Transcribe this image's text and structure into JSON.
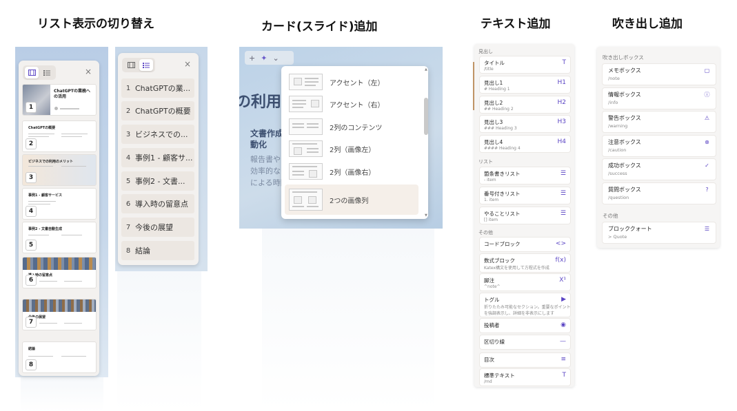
{
  "titles": {
    "list_toggle": "リスト表示の切り替え",
    "add_card": "カード(スライド)追加",
    "add_text": "テキスト追加",
    "add_callout": "吹き出し追加"
  },
  "thumb_panel": {
    "close": "×",
    "slides": [
      {
        "num": "1",
        "title": "ChatGPTの業務への活用"
      },
      {
        "num": "2",
        "title": "ChatGPTの概要"
      },
      {
        "num": "3",
        "title": "ビジネスでの利用のメリット"
      },
      {
        "num": "4",
        "title": "事例1 - 顧客サービス"
      },
      {
        "num": "5",
        "title": "事例2 - 文書自動生成"
      },
      {
        "num": "6",
        "title": "導入時の留意点"
      },
      {
        "num": "7",
        "title": "今後の展望"
      },
      {
        "num": "8",
        "title": "結論"
      }
    ]
  },
  "list_panel": {
    "close": "×",
    "items": [
      {
        "num": "1",
        "label": "ChatGPTの業..."
      },
      {
        "num": "2",
        "label": "ChatGPTの概要"
      },
      {
        "num": "3",
        "label": "ビジネスでの..."
      },
      {
        "num": "4",
        "label": "事例1 - 顧客サ..."
      },
      {
        "num": "5",
        "label": "事例2 - 文書..."
      },
      {
        "num": "6",
        "label": "導入時の留意点"
      },
      {
        "num": "7",
        "label": "今後の展望"
      },
      {
        "num": "8",
        "label": "結論"
      }
    ]
  },
  "card_panel": {
    "toolbar_plus": "+",
    "toolbar_magic": "✦",
    "toolbar_chevron": "⌄",
    "heading": "の利用の",
    "subheading": "文書作成",
    "subheading2": "動化",
    "body1": "報告書やメ",
    "body2": "効率的な自",
    "body3": "による時間",
    "options": [
      {
        "label": "アクセント（左）"
      },
      {
        "label": "アクセント（右）"
      },
      {
        "label": "2列のコンテンツ"
      },
      {
        "label": "2列（画像左）"
      },
      {
        "label": "2列（画像右）"
      },
      {
        "label": "2つの画像列"
      }
    ]
  },
  "text_panel": {
    "groups": {
      "heading": "見出し",
      "list": "リスト",
      "other": "その他"
    },
    "items": [
      {
        "name": "タイトル",
        "sub": "/title",
        "icon": "T"
      },
      {
        "name": "見出し1",
        "sub": "# Heading 1",
        "icon": "H1"
      },
      {
        "name": "見出し2",
        "sub": "## Heading 2",
        "icon": "H2"
      },
      {
        "name": "見出し3",
        "sub": "### Heading 3",
        "icon": "H3"
      },
      {
        "name": "見出し4",
        "sub": "#### Heading 4",
        "icon": "H4"
      },
      {
        "name": "箇条書きリスト",
        "sub": "- item",
        "icon": "☰"
      },
      {
        "name": "番号付きリスト",
        "sub": "1. item",
        "icon": "☰"
      },
      {
        "name": "やることリスト",
        "sub": "[] item",
        "icon": "☰"
      },
      {
        "name": "コードブロック",
        "sub": "",
        "icon": "<>"
      },
      {
        "name": "数式ブロック",
        "sub": "Katex構文を使用して方程式を作成",
        "icon": "f(x)"
      },
      {
        "name": "脚注",
        "sub": "^note^",
        "icon": "X¹"
      },
      {
        "name": "トグル",
        "sub": "折りたたみ可能なセクション。重要なポイント",
        "sub2": "を強調表示し、詳細を非表示にします",
        "icon": "▶"
      },
      {
        "name": "投稿者",
        "sub": "",
        "icon": "◉"
      },
      {
        "name": "区切り線",
        "sub": "",
        "icon": "—"
      },
      {
        "name": "目次",
        "sub": "",
        "icon": "≡"
      },
      {
        "name": "標準テキスト",
        "sub": "/md",
        "icon": "T"
      }
    ]
  },
  "callout_panel": {
    "group_box": "吹き出しボックス",
    "group_other": "その他",
    "boxes": [
      {
        "name": "メモボックス",
        "sub": "/note",
        "icon": "▢"
      },
      {
        "name": "情報ボックス",
        "sub": "/info",
        "icon": "ⓘ"
      },
      {
        "name": "警告ボックス",
        "sub": "/warning",
        "icon": "⚠"
      },
      {
        "name": "注意ボックス",
        "sub": "/caution",
        "icon": "⊗"
      },
      {
        "name": "成功ボックス",
        "sub": "/success",
        "icon": "✓"
      },
      {
        "name": "質問ボックス",
        "sub": "/question",
        "icon": "?"
      }
    ],
    "quote": {
      "name": "ブロッククォート",
      "sub": "> Quote",
      "icon": "☰"
    }
  }
}
